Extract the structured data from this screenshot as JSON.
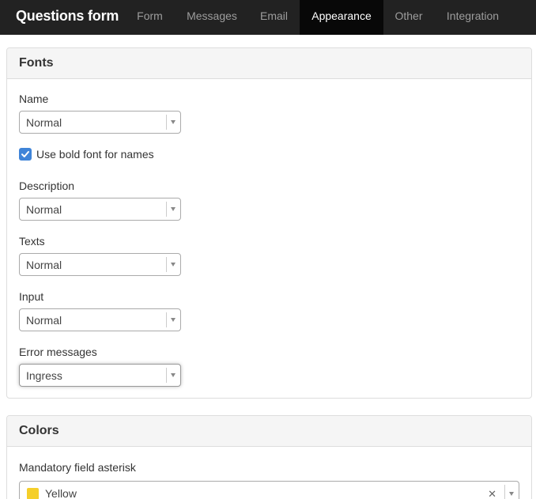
{
  "navbar": {
    "brand": "Questions form",
    "tabs": [
      {
        "label": "Form"
      },
      {
        "label": "Messages"
      },
      {
        "label": "Email"
      },
      {
        "label": "Appearance",
        "active": true
      },
      {
        "label": "Other"
      },
      {
        "label": "Integration"
      }
    ]
  },
  "fonts_panel": {
    "title": "Fonts",
    "name": {
      "label": "Name",
      "value": "Normal"
    },
    "bold_names": {
      "label": "Use bold font for names",
      "checked": true
    },
    "description": {
      "label": "Description",
      "value": "Normal"
    },
    "texts": {
      "label": "Texts",
      "value": "Normal"
    },
    "input": {
      "label": "Input",
      "value": "Normal"
    },
    "error_messages": {
      "label": "Error messages",
      "value": "Ingress"
    }
  },
  "colors_panel": {
    "title": "Colors",
    "asterisk": {
      "label": "Mandatory field asterisk",
      "value": "Yellow",
      "swatch_color": "#f5cf2a"
    }
  },
  "colors": {
    "navbar_bg": "#222222",
    "active_tab_bg": "#080808",
    "checkbox_blue": "#3f84d8"
  },
  "icons": {
    "checkbox": "check-icon",
    "dropdown": "chevron-down-icon",
    "clear": "close-icon"
  }
}
